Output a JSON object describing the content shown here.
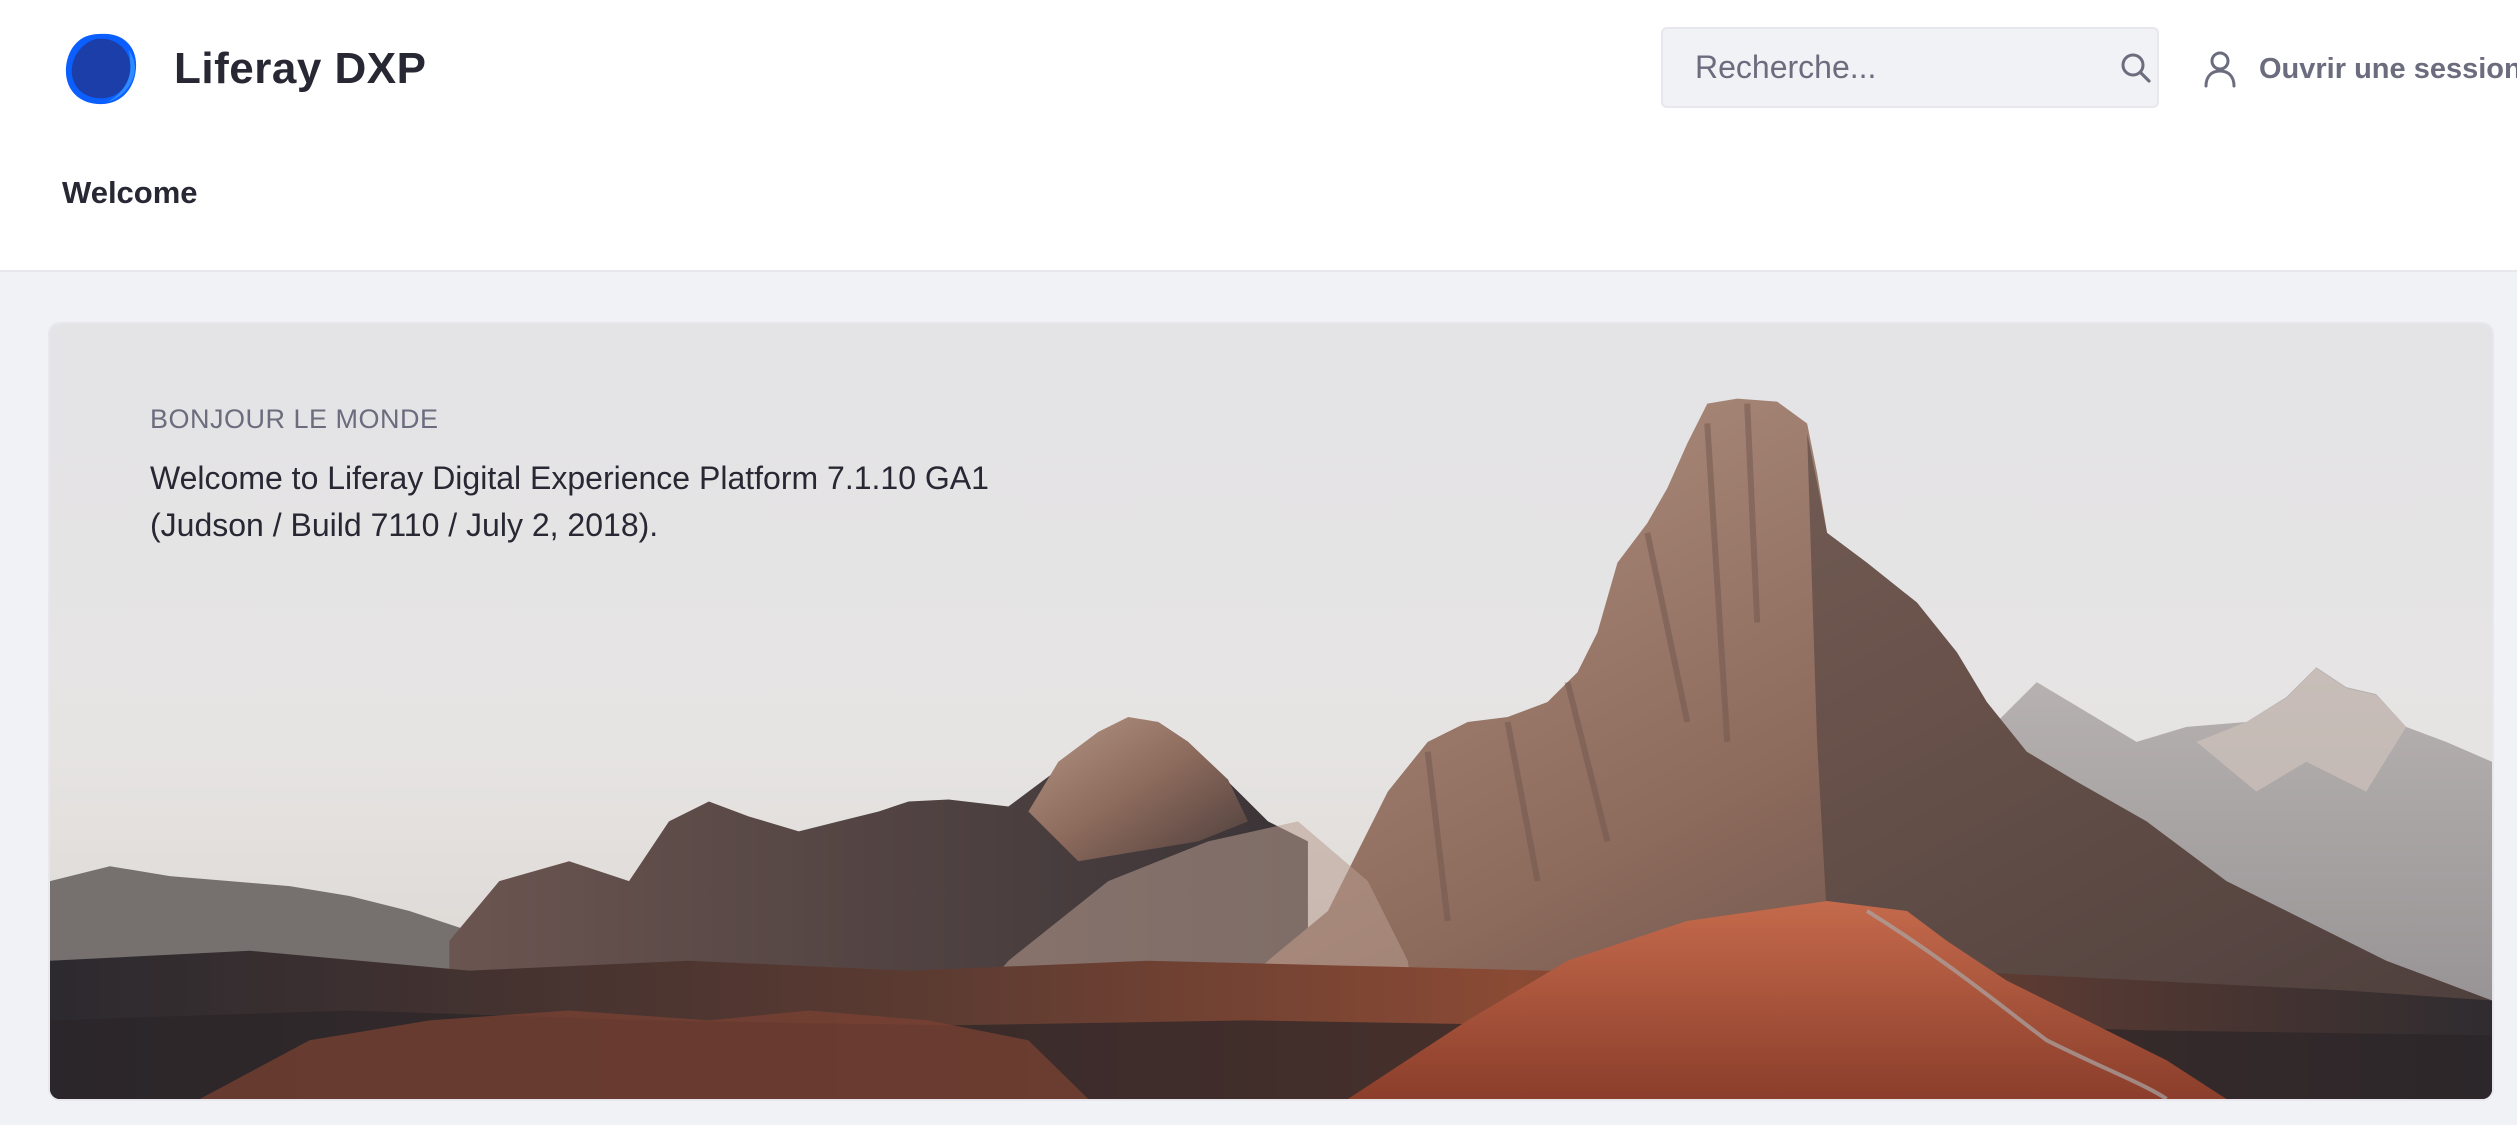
{
  "header": {
    "brand": {
      "name": "Liferay DXP",
      "logo_icon": "liferay-logo-icon"
    },
    "search": {
      "placeholder": "Recherche...",
      "value": "",
      "icon": "search-icon"
    },
    "signin": {
      "label": "Ouvrir une session",
      "icon": "user-icon"
    }
  },
  "nav": {
    "items": [
      {
        "label": "Welcome"
      }
    ]
  },
  "hero": {
    "kicker": "BONJOUR LE MONDE",
    "lines": [
      "Welcome to Liferay Digital Experience Platform 7.1.10 GA1",
      "(Judson / Build 7110 / July 2, 2018)."
    ],
    "image": "mountain-landscape"
  },
  "colors": {
    "header_bg": "#ffffff",
    "page_bg": "#f1f2f5",
    "text_primary": "#272833",
    "text_secondary": "#6b6c7e",
    "brand_blue": "#0b5fff",
    "brand_dark_blue": "#1b3ea8"
  }
}
